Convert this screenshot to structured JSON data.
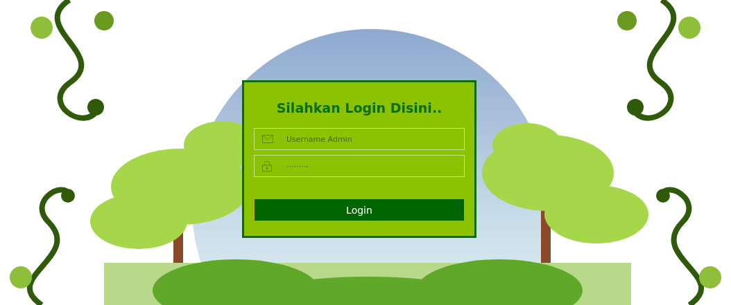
{
  "login_form": {
    "title": "Silahkan Login Disini..",
    "fields": [
      {
        "kind": "text",
        "placeholder": "Username Admin"
      },
      {
        "kind": "password",
        "placeholder": "·········"
      }
    ],
    "submit_button": "Login"
  }
}
